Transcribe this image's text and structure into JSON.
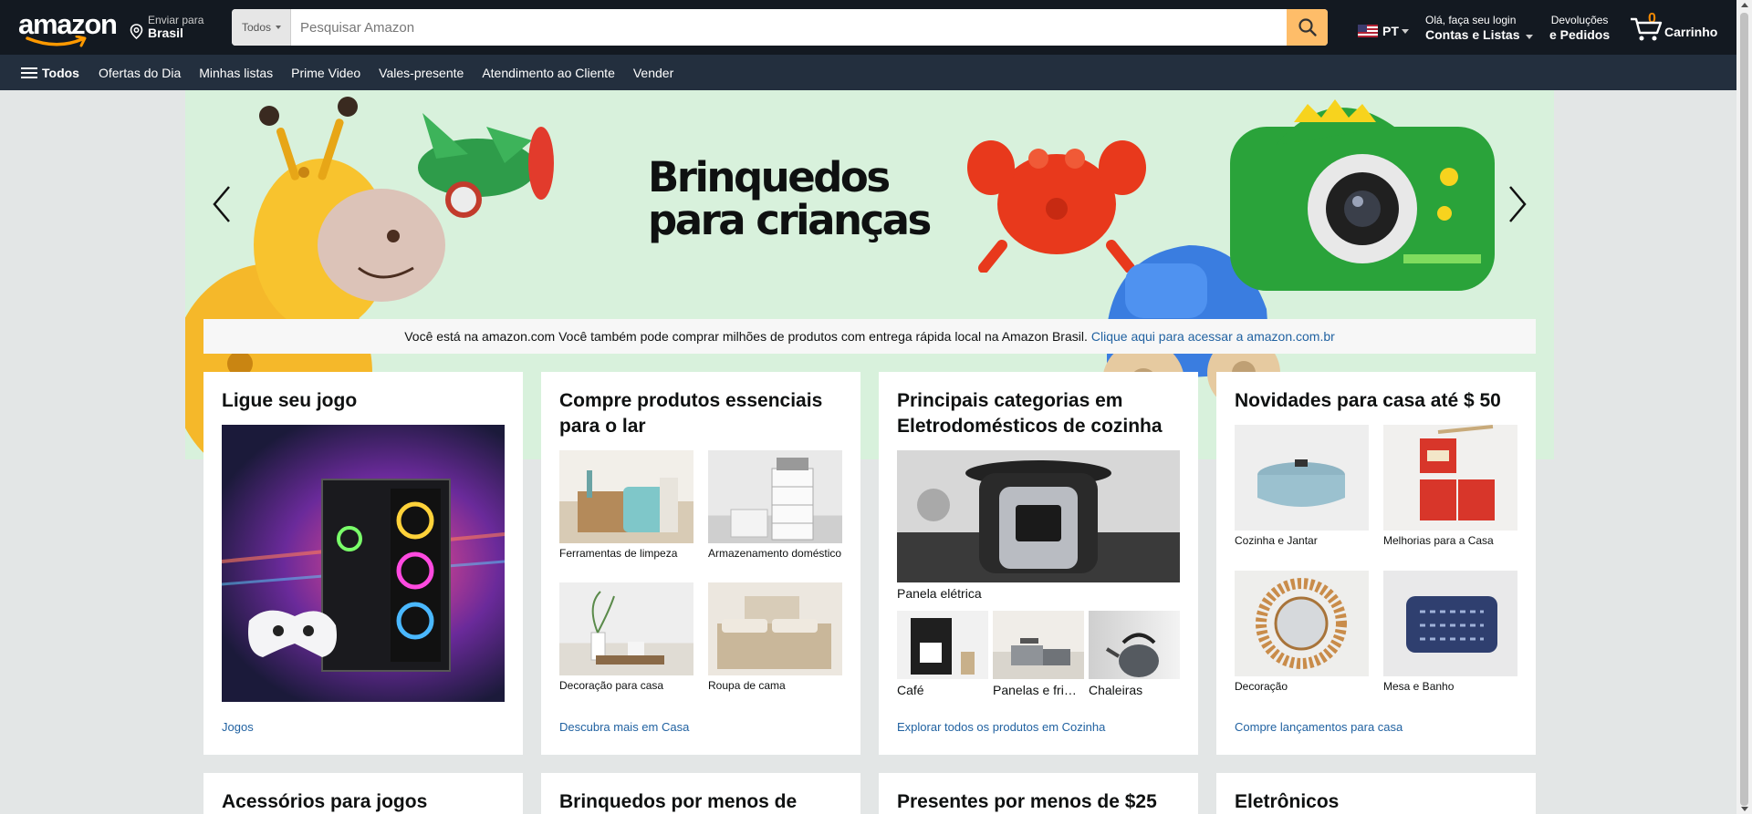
{
  "header": {
    "logo_text": "amazon",
    "deliver_line1": "Enviar para",
    "deliver_line2": "Brasil",
    "search_category": "Todos",
    "search_placeholder": "Pesquisar Amazon",
    "language": "PT",
    "account_line1": "Olá, faça seu login",
    "account_line2": "Contas e Listas",
    "returns_line1": "Devoluções",
    "returns_line2": "e Pedidos",
    "cart_count": "0",
    "cart_label": "Carrinho"
  },
  "subnav": {
    "all_label": "Todos",
    "items": [
      "Ofertas do Dia",
      "Minhas listas",
      "Prime Video",
      "Vales-presente",
      "Atendimento ao Cliente",
      "Vender"
    ]
  },
  "hero": {
    "title_line1": "Brinquedos",
    "title_line2": "para crianças",
    "notice_text": "Você está na amazon.com Você também pode comprar milhões de produtos com entrega rápida local na Amazon Brasil.",
    "notice_link": "Clique aqui para acessar a amazon.com.br"
  },
  "cards": [
    {
      "title": "Ligue seu jogo",
      "link": "Jogos"
    },
    {
      "title": "Compre produtos essenciais para o lar",
      "items": [
        "Ferramentas de limpeza",
        "Armazenamento doméstico",
        "Decoração para casa",
        "Roupa de cama"
      ],
      "link": "Descubra mais em Casa"
    },
    {
      "title": "Principais categorias em Eletrodomésticos de cozinha",
      "main_caption": "Panela elétrica",
      "items": [
        "Café",
        "Panelas e fri…",
        "Chaleiras"
      ],
      "link": "Explorar todos os produtos em Cozinha"
    },
    {
      "title": "Novidades para casa até $ 50",
      "items": [
        "Cozinha e Jantar",
        "Melhorias para a Casa",
        "Decoração",
        "Mesa e Banho"
      ],
      "link": "Compre lançamentos para casa"
    }
  ],
  "cards_row2": [
    "Acessórios para jogos",
    "Brinquedos por menos de USD",
    "Presentes por menos de $25",
    "Eletrônicos"
  ],
  "colors": {
    "nav_top": "#131921",
    "nav_sub": "#232f3e",
    "search_button": "#febd69",
    "cart_count": "#f08804",
    "link": "#2162a1",
    "hero_bg": "#d8f1dc"
  }
}
